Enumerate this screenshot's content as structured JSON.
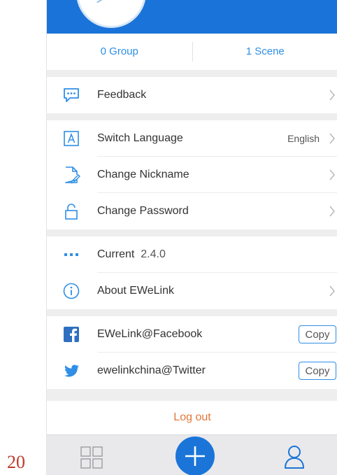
{
  "page_number": "20",
  "stats": {
    "group": "0 Group",
    "scene": "1 Scene"
  },
  "menu": {
    "feedback": {
      "label": "Feedback",
      "icon": "feedback-icon"
    },
    "switch_language": {
      "label": "Switch Language",
      "value": "English",
      "icon": "language-icon"
    },
    "change_nickname": {
      "label": "Change Nickname",
      "icon": "edit-document-icon"
    },
    "change_password": {
      "label": "Change Password",
      "icon": "lock-icon"
    },
    "current_version": {
      "label": "Current",
      "value": "2.4.0",
      "icon": "more-dots-icon"
    },
    "about": {
      "label": "About EWeLink",
      "icon": "info-icon"
    }
  },
  "social": {
    "facebook": {
      "label": "EWeLink@Facebook",
      "button": "Copy",
      "icon": "facebook-icon"
    },
    "twitter": {
      "label": "ewelinkchina@Twitter",
      "button": "Copy",
      "icon": "twitter-icon"
    }
  },
  "logout_label": "Log out",
  "tabbar": {
    "items": [
      "grid-icon",
      "add-icon",
      "user-icon"
    ]
  },
  "colors": {
    "header": "#1a73d9",
    "accent": "#2f8ee6",
    "logout": "#e0773a",
    "page_number": "#c0392b"
  }
}
